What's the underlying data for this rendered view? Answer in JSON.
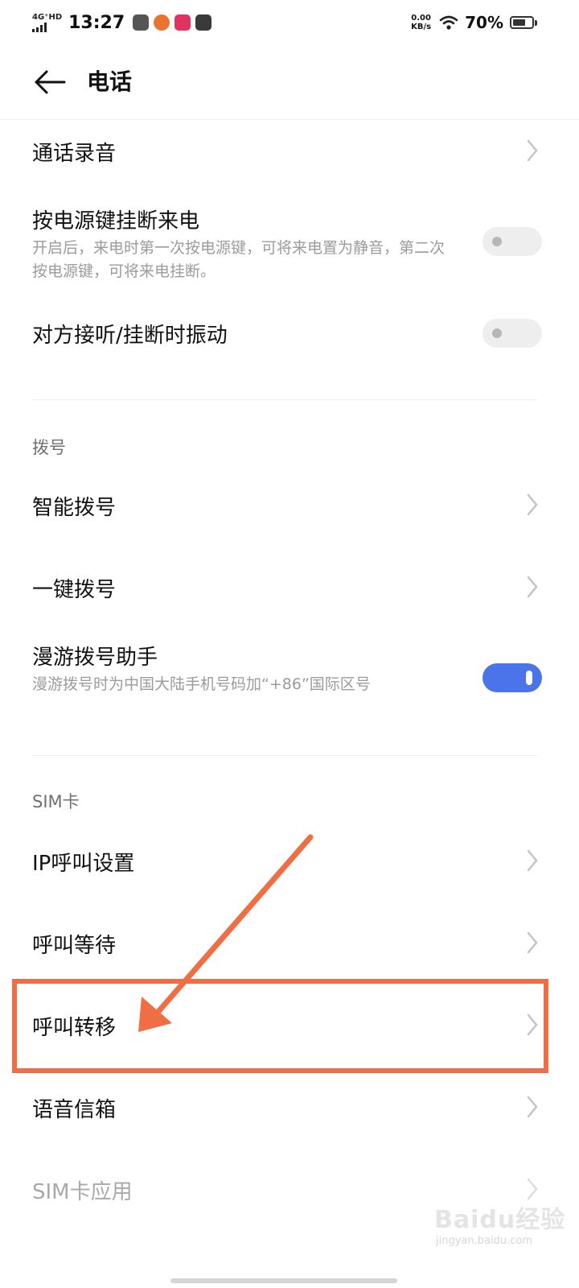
{
  "status_bar": {
    "network": "4G⁺HD",
    "time": "13:27",
    "speed_value": "0.00",
    "speed_unit": "KB/s",
    "battery": "70%",
    "battery_level": 0.7,
    "app_icons": [
      "game-controller-icon",
      "pumpkin-icon",
      "pink-app-icon",
      "dark-app-icon"
    ]
  },
  "header": {
    "title": "电话",
    "back_icon": "arrow-left-icon"
  },
  "items": {
    "call_recording": {
      "title": "通话录音"
    },
    "power_hangup": {
      "title": "按电源键挂断来电",
      "subtitle": "开启后，来电时第一次按电源键，可将来电置为静音，第二次按电源键，可将来电挂断。",
      "enabled": false
    },
    "vibrate": {
      "title": "对方接听/挂断时振动",
      "enabled": false
    },
    "smart_dial": {
      "title": "智能拨号"
    },
    "one_key_dial": {
      "title": "一键拨号"
    },
    "roaming": {
      "title": "漫游拨号助手",
      "subtitle": "漫游拨号时为中国大陆手机号码加“+86”国际区号",
      "enabled": true
    },
    "ip_call": {
      "title": "IP呼叫设置"
    },
    "call_waiting": {
      "title": "呼叫等待"
    },
    "call_forwarding": {
      "title": "呼叫转移"
    },
    "voicemail": {
      "title": "语音信箱"
    },
    "sim_apps": {
      "title": "SIM卡应用"
    }
  },
  "sections": {
    "dial": "拨号",
    "sim": "SIM卡"
  },
  "annotation": {
    "color": "#ef6e44"
  },
  "colors": {
    "accent": "#4b73ea",
    "secondary_text": "#9b9b9b"
  },
  "watermark": {
    "brand": "Baidu经验",
    "domain": "jingyan.baidu.com"
  }
}
